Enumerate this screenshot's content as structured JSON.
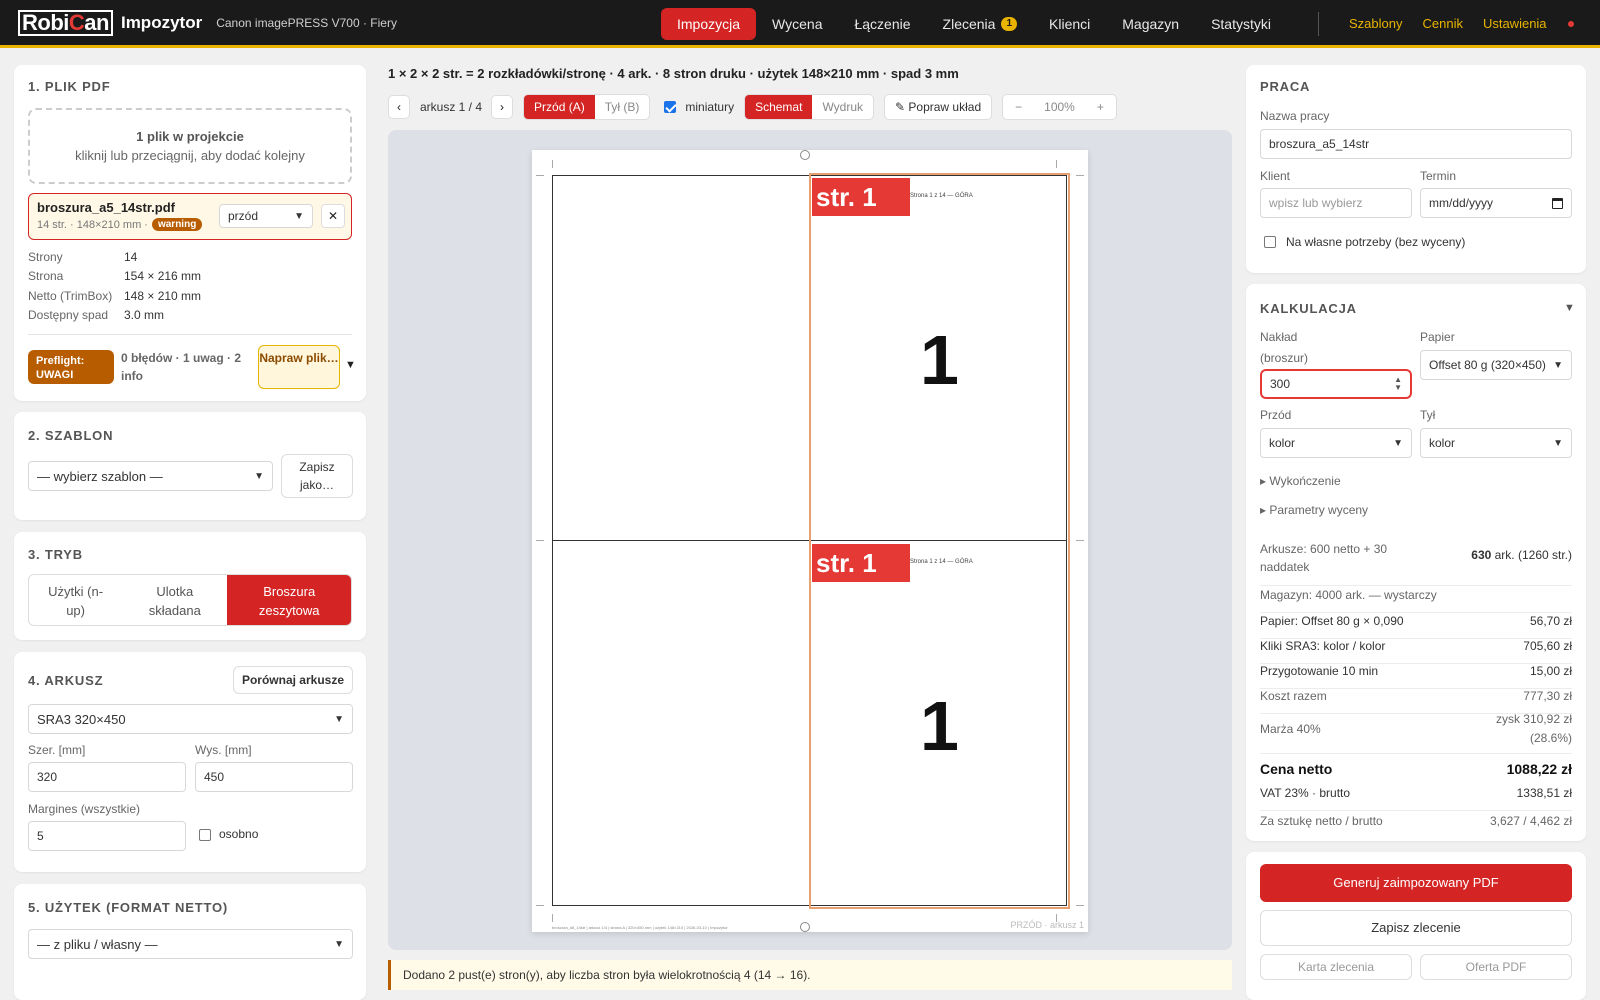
{
  "topbar": {
    "logo_part1": "Robi",
    "logo_part2": "C",
    "logo_part3": "an",
    "app_name": "Impozytor",
    "device": "Canon imagePRESS V700 · Fiery",
    "nav": [
      "Impozycja",
      "Wycena",
      "Łączenie",
      "Zlecenia",
      "Klienci",
      "Magazyn",
      "Statystyki"
    ],
    "nav_badge": "1",
    "side_nav": [
      "Szablony",
      "Cennik",
      "Ustawienia"
    ]
  },
  "pdf_panel": {
    "title": "1. PLIK PDF",
    "drop_line1": "1 plik w projekcie",
    "drop_line2": "kliknij lub przeciągnij, aby dodać kolejny",
    "file_name": "broszura_a5_14str.pdf",
    "file_meta": "14 str. · 148×210 mm ·",
    "file_badge": "warning",
    "file_side": "przód",
    "remove": "✕",
    "props": [
      {
        "k": "Strony",
        "v": "14"
      },
      {
        "k": "Strona",
        "v": "154 × 216 mm"
      },
      {
        "k": "Netto (TrimBox)",
        "v": "148 × 210 mm"
      },
      {
        "k": "Dostępny spad",
        "v": "3.0 mm"
      }
    ],
    "preflight_badge": "Preflight: UWAGI",
    "preflight_text": "0 błędów · 1 uwag · 2 info",
    "fix_btn": "Napraw plik…",
    "expand": "▼"
  },
  "template_panel": {
    "title": "2. SZABLON",
    "select": "— wybierz szablon —",
    "save_as": "Zapisz jako…"
  },
  "mode_panel": {
    "title": "3. TRYB",
    "modes": [
      "Użytki (n-up)",
      "Ulotka składana",
      "Broszura zeszytowa"
    ]
  },
  "sheet_panel": {
    "title": "4. ARKUSZ",
    "compare": "Porównaj arkusze",
    "format": "SRA3 320×450",
    "w_label": "Szer. [mm]",
    "w_val": "320",
    "h_label": "Wys. [mm]",
    "h_val": "450",
    "m_label": "Margines (wszystkie)",
    "m_val": "5",
    "separate": "osobno"
  },
  "usage_panel": {
    "title": "5. UŻYTEK (FORMAT NETTO)",
    "select": "— z pliku / własny —"
  },
  "center": {
    "summary": "1 × 2 × 2 str. = 2 rozkładówki/stronę · 4 ark. · 8 stron druku · użytek 148×210 mm · spad 3 mm",
    "prev": "‹",
    "next": "›",
    "sheet_counter": "arkusz 1 / 4",
    "side_front": "Przód (A)",
    "side_back": "Tył (B)",
    "thumbnails": "miniatury",
    "view_schema": "Schemat",
    "view_print": "Wydruk",
    "fix_layout": "✎ Popraw układ",
    "zoom_out": "−",
    "zoom": "100%",
    "zoom_in": "+",
    "page_tag": "str. 1",
    "page_tiny": "Strona 1 z 14 — GÓRA",
    "page_big": "1",
    "sheet_footer": "PRZÓD · arkusz 1",
    "sheet_footer_left": "broszura_a5_14str | arkusz 1/4 | strona A | 320×450 mm | użytek 148×210 | 2026-03-10 | Impozytor",
    "notice": "Dodano 2 pust(e) stron(y), aby liczba stron była wielokrotnością 4 (14 → 16)."
  },
  "job_panel": {
    "title": "PRACA",
    "name_label": "Nazwa pracy",
    "name_val": "broszura_a5_14str",
    "client_label": "Klient",
    "client_ph": "wpisz lub wybierz",
    "due_label": "Termin",
    "due_ph": "mm/dd/yyyy",
    "own_use": "Na własne potrzeby (bez wyceny)"
  },
  "calc_panel": {
    "title": "KALKULACJA",
    "toggle": "▼",
    "qty_label1": "Nakład",
    "qty_label2": "(broszur)",
    "qty_val": "300",
    "paper_label": "Papier",
    "paper_val": "Offset 80 g (320×450)",
    "front_label": "Przód",
    "front_val": "kolor",
    "back_label": "Tył",
    "back_val": "kolor",
    "finishing": "▸ Wykończenie",
    "params": "▸ Parametry wyceny",
    "sheets_label": "Arkusze: 600 netto + 30 naddatek",
    "sheets_val_bold": "630",
    "sheets_val": " ark. (1260 str.)",
    "stock": "Magazyn: 4000 ark. — wystarczy",
    "rows": [
      {
        "k": "Papier: Offset 80 g × 0,090",
        "v": "56,70 zł"
      },
      {
        "k": "Kliki SRA3: kolor / kolor",
        "v": "705,60 zł"
      },
      {
        "k": "Przygotowanie 10 min",
        "v": "15,00 zł"
      },
      {
        "k": "Koszt razem",
        "v": "777,30 zł"
      }
    ],
    "margin_label": "Marża 40%",
    "margin_val1": "zysk 310,92 zł",
    "margin_val2": "(28.6%)",
    "net_label": "Cena netto",
    "net_val": "1088,22 zł",
    "vat_label": "VAT 23% · brutto",
    "vat_val": "1338,51 zł",
    "unit_label": "Za sztukę netto / brutto",
    "unit_val": "3,627 / 4,462 zł"
  },
  "actions": {
    "generate": "Generuj zaimpozowany PDF",
    "save_order": "Zapisz zlecenie",
    "order_card": "Karta zlecenia",
    "offer_pdf": "Oferta PDF"
  }
}
